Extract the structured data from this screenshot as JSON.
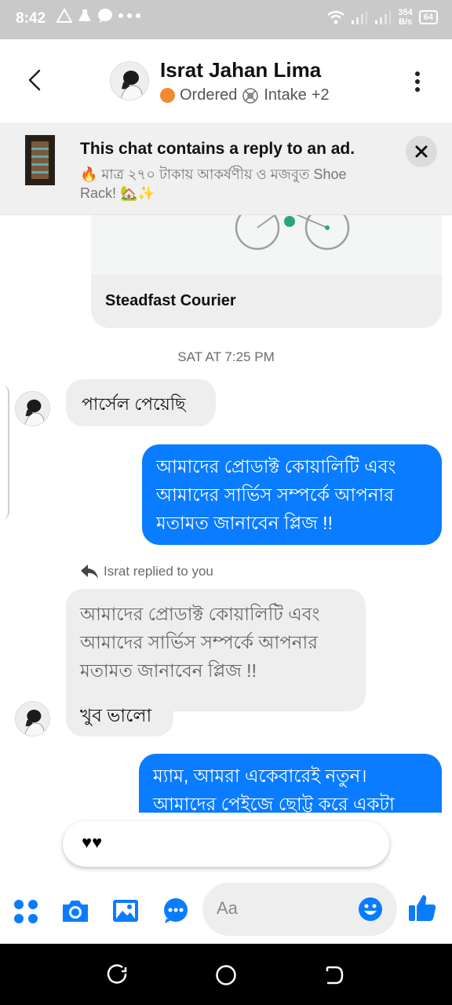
{
  "status_bar": {
    "time": "8:42",
    "net_speed_value": "354",
    "net_speed_unit": "B/s",
    "battery": "64"
  },
  "header": {
    "name": "Israt Jahan Lima",
    "label_ordered": "Ordered",
    "label_intake": "Intake",
    "extra_labels": "+2"
  },
  "ad_banner": {
    "title": "This chat contains a reply to an ad.",
    "text": "🔥 মাত্র ২৭০ টাকায় আকর্ষণীয় ও মজবুত  Shoe Rack! 🏡✨"
  },
  "card": {
    "title": "Steadfast Courier"
  },
  "timestamp": "SAT AT 7:25 PM",
  "messages": {
    "in1": "পার্সেল পেয়েছি",
    "out1": "আমাদের প্রোডাক্ট কোয়ালিটি এবং আমাদের সার্ভিস সম্পর্কে আপনার মতামত জানাবেন প্লিজ !!",
    "replied_label": "Israt replied to you",
    "quoted": "আমাদের প্রোডাক্ট কোয়ালিটি এবং আমাদের সার্ভিস সম্পর্কে আপনার মতামত জানাবেন প্লিজ !!",
    "in2": "খুব ভালো",
    "out2_line1": "ম্যাম, আমরা একেবারেই নতুন।",
    "out2_line2": "আমাদের পেইজে ছোট্ট করে একটা"
  },
  "reaction": "♥♥",
  "composer": {
    "placeholder": "Aa"
  },
  "colors": {
    "accent": "#0a7cff",
    "status_bar": "#c9c9c9",
    "ordered_label": "#f28a30",
    "bubble_incoming": "#eeeeee"
  },
  "icons": [
    "back-arrow-icon",
    "more-vert-icon",
    "intake-label-icon",
    "close-icon",
    "reply-arrow-icon",
    "apps-grid-icon",
    "camera-icon",
    "gallery-icon",
    "chat-more-icon",
    "emoji-icon",
    "thumbs-up-icon",
    "recents-nav-icon",
    "home-nav-icon",
    "back-nav-icon"
  ]
}
